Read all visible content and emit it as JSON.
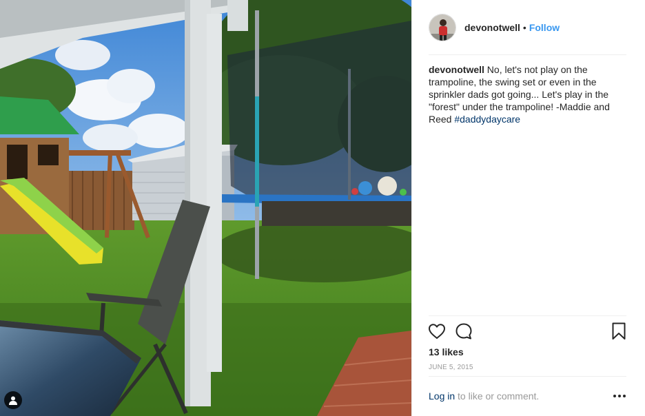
{
  "post": {
    "username": "devonotwell",
    "separator": "•",
    "follow_label": "Follow",
    "caption": {
      "username": "devonotwell",
      "text": "No, let's not play on the trampoline, the swing set or even in the sprinkler dads got going... Let's play in the \"forest\" under the trampoline! -Maddie and Reed",
      "hashtag": "#daddydaycare"
    },
    "likes": "13 likes",
    "date": "JUNE 5, 2015",
    "footer": {
      "login_label": "Log in",
      "suffix": " to like or comment."
    }
  },
  "icons": {
    "like": "heart-icon",
    "comment": "comment-bubble-icon",
    "save": "bookmark-icon",
    "more": "more-options-icon",
    "tagged": "user-tag-icon"
  },
  "colors": {
    "link": "#3897f0",
    "hashtag": "#003569",
    "meta": "#999999",
    "text": "#262626"
  }
}
